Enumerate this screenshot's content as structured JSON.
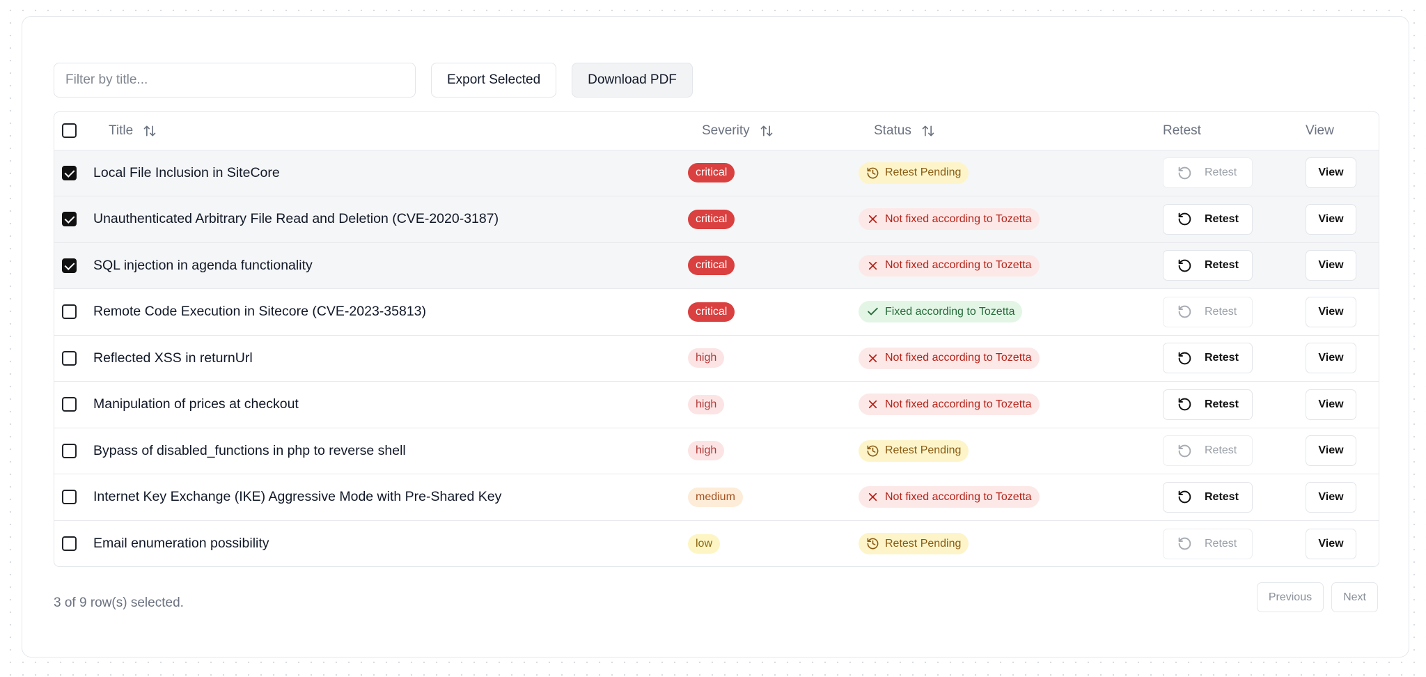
{
  "toolbar": {
    "filter_placeholder": "Filter by title...",
    "export_label": "Export Selected",
    "download_label": "Download PDF"
  },
  "table": {
    "headers": {
      "title": "Title",
      "severity": "Severity",
      "status": "Status",
      "retest": "Retest",
      "view": "View"
    },
    "rows": [
      {
        "checked": true,
        "title": "Local File Inclusion in SiteCore",
        "severity": "critical",
        "status": "Retest Pending",
        "status_type": "pending",
        "retest_label": "Retest",
        "retest_enabled": false,
        "view_label": "View"
      },
      {
        "checked": true,
        "title": "Unauthenticated Arbitrary File Read and Deletion (CVE-2020-3187)",
        "severity": "critical",
        "status": "Not fixed according to Tozetta",
        "status_type": "notfixed",
        "retest_label": "Retest",
        "retest_enabled": true,
        "view_label": "View"
      },
      {
        "checked": true,
        "title": "SQL injection in agenda functionality",
        "severity": "critical",
        "status": "Not fixed according to Tozetta",
        "status_type": "notfixed",
        "retest_label": "Retest",
        "retest_enabled": true,
        "view_label": "View"
      },
      {
        "checked": false,
        "title": "Remote Code Execution in Sitecore (CVE-2023-35813)",
        "severity": "critical",
        "status": "Fixed according to Tozetta",
        "status_type": "fixed",
        "retest_label": "Retest",
        "retest_enabled": false,
        "view_label": "View"
      },
      {
        "checked": false,
        "title": "Reflected XSS in returnUrl",
        "severity": "high",
        "status": "Not fixed according to Tozetta",
        "status_type": "notfixed",
        "retest_label": "Retest",
        "retest_enabled": true,
        "view_label": "View"
      },
      {
        "checked": false,
        "title": "Manipulation of prices at checkout",
        "severity": "high",
        "status": "Not fixed according to Tozetta",
        "status_type": "notfixed",
        "retest_label": "Retest",
        "retest_enabled": true,
        "view_label": "View"
      },
      {
        "checked": false,
        "title": "Bypass of disabled_functions in php to reverse shell",
        "severity": "high",
        "status": "Retest Pending",
        "status_type": "pending",
        "retest_label": "Retest",
        "retest_enabled": false,
        "view_label": "View"
      },
      {
        "checked": false,
        "title": "Internet Key Exchange (IKE) Aggressive Mode with Pre-Shared Key",
        "severity": "medium",
        "status": "Not fixed according to Tozetta",
        "status_type": "notfixed",
        "retest_label": "Retest",
        "retest_enabled": true,
        "view_label": "View"
      },
      {
        "checked": false,
        "title": "Email enumeration possibility",
        "severity": "low",
        "status": "Retest Pending",
        "status_type": "pending",
        "retest_label": "Retest",
        "retest_enabled": false,
        "view_label": "View"
      }
    ]
  },
  "footer": {
    "selection_text": "3 of 9 row(s) selected.",
    "previous_label": "Previous",
    "next_label": "Next"
  },
  "colors": {
    "critical": "#d9403f",
    "high_bg": "#fce4e4",
    "medium_bg": "#fdecd8",
    "low_bg": "#fdf6c4",
    "pending_bg": "#fdf5c9",
    "notfixed_bg": "#fde8e8",
    "fixed_bg": "#e3f6e6"
  }
}
